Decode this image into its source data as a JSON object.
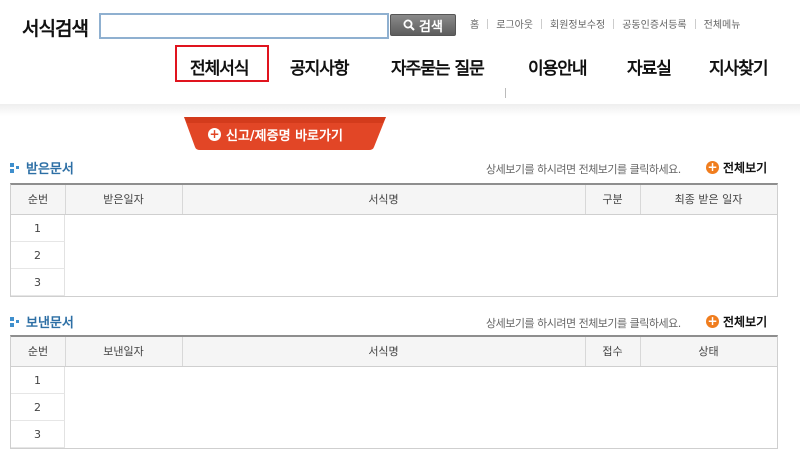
{
  "header": {
    "search_label": "서식검색",
    "search_value": "",
    "search_button": "검색",
    "util_links": [
      "홈",
      "로그아웃",
      "회원정보수정",
      "공동인증서등록",
      "전체메뉴"
    ]
  },
  "gnb": {
    "items": [
      "전체서식",
      "공지사항",
      "자주묻는 질문",
      "이용안내",
      "자료실",
      "지사찾기"
    ],
    "active": "전체서식"
  },
  "shortcut": {
    "label": "신고/제증명 바로가기"
  },
  "received": {
    "title": "받은문서",
    "hint": "상세보기를 하시려면 전체보기를 클릭하세요.",
    "view_all": "전체보기",
    "columns": [
      "순번",
      "받은일자",
      "서식명",
      "구분",
      "최종 받은 일자"
    ],
    "rows": [
      "1",
      "2",
      "3"
    ]
  },
  "sent": {
    "title": "보낸문서",
    "hint": "상세보기를 하시려면 전체보기를 클릭하세요.",
    "view_all": "전체보기",
    "columns": [
      "순번",
      "보낸일자",
      "서식명",
      "접수",
      "상태"
    ],
    "rows": [
      "1",
      "2",
      "3"
    ]
  },
  "colors": {
    "active_border": "#e0141e",
    "shortcut_bg": "#e24626",
    "section_title": "#2d6fa5",
    "view_all_icon": "#f07d1e"
  },
  "icons": [
    "search-icon",
    "plus-circle-icon",
    "section-bullet-icon"
  ]
}
